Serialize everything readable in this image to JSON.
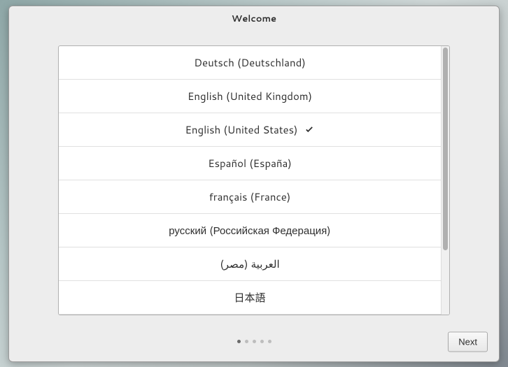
{
  "header": {
    "title": "Welcome"
  },
  "languages": [
    {
      "label": "Deutsch (Deutschland)",
      "selected": false
    },
    {
      "label": "English (United Kingdom)",
      "selected": false
    },
    {
      "label": "English (United States)",
      "selected": true
    },
    {
      "label": "Español (España)",
      "selected": false
    },
    {
      "label": "français (France)",
      "selected": false
    },
    {
      "label": "русский (Российская Федерация)",
      "selected": false
    },
    {
      "label": "العربية (مصر)",
      "selected": false
    },
    {
      "label": "日本語",
      "selected": false
    }
  ],
  "pagination": {
    "total": 5,
    "current": 0
  },
  "footer": {
    "next_label": "Next"
  }
}
